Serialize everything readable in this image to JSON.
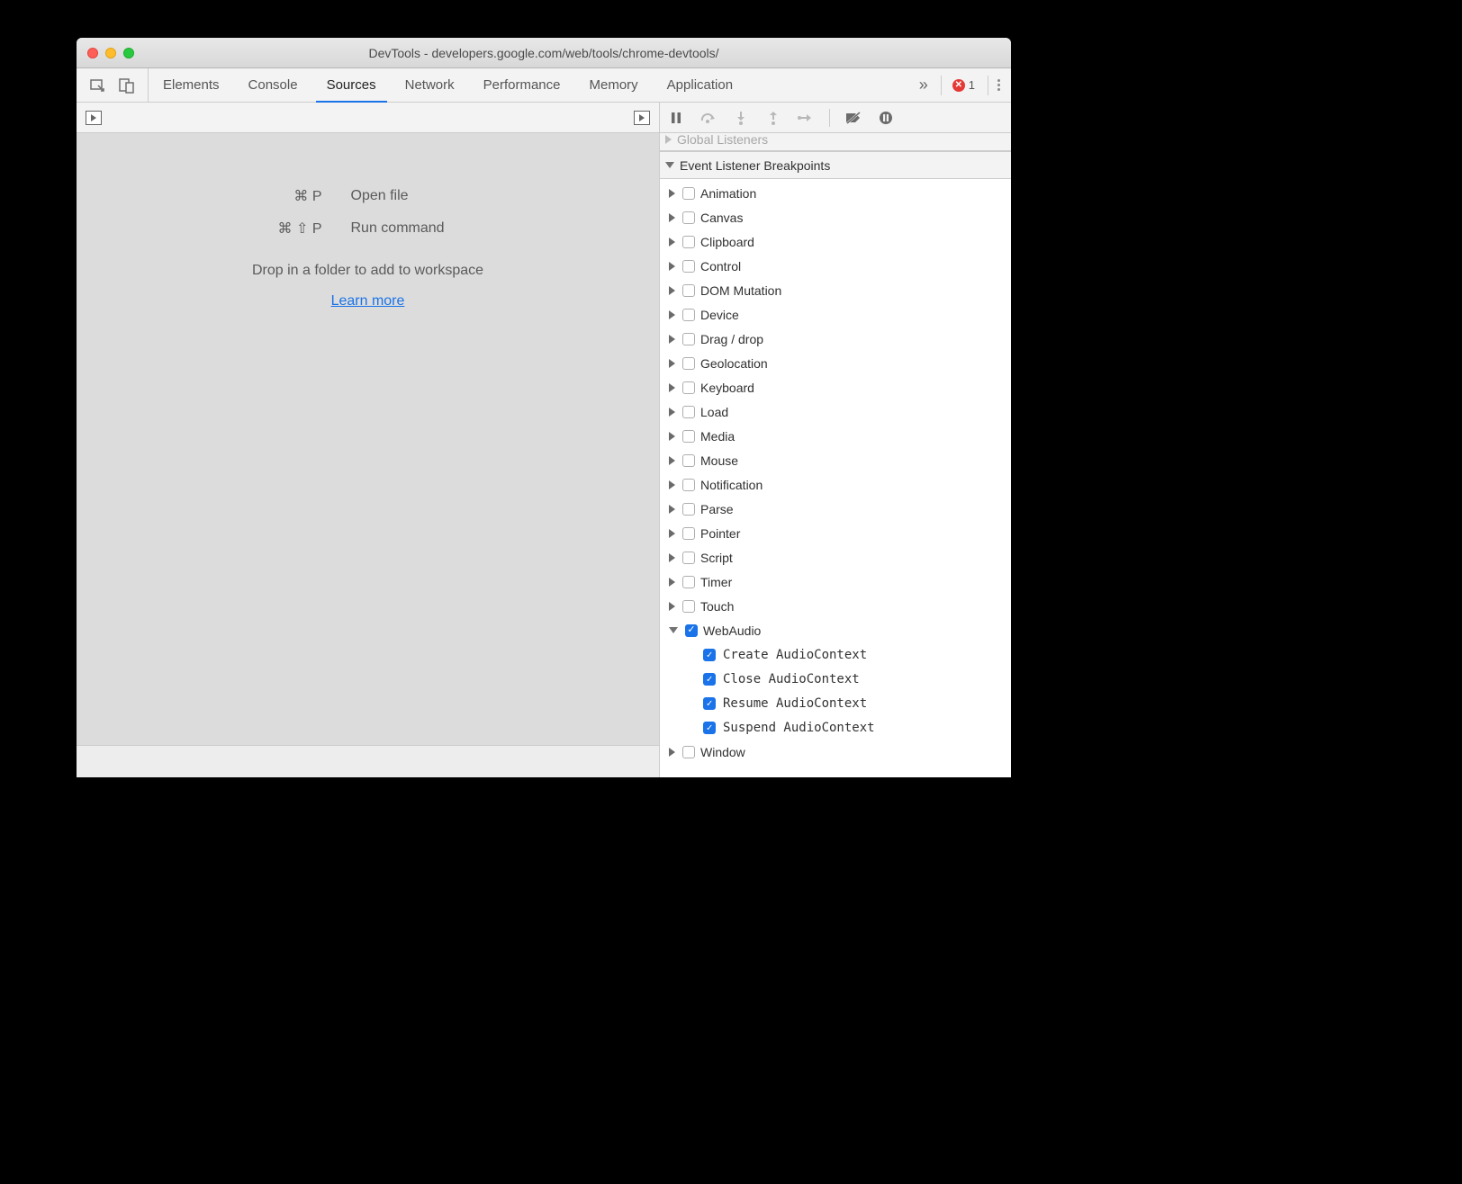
{
  "window": {
    "title": "DevTools - developers.google.com/web/tools/chrome-devtools/"
  },
  "tabs": {
    "items": [
      "Elements",
      "Console",
      "Sources",
      "Network",
      "Performance",
      "Memory",
      "Application"
    ],
    "active": "Sources",
    "error_count": "1"
  },
  "help": {
    "shortcut1_keys": "⌘ P",
    "shortcut1_label": "Open file",
    "shortcut2_keys": "⌘ ⇧ P",
    "shortcut2_label": "Run command",
    "drop_hint": "Drop in a folder to add to workspace",
    "learn_more": "Learn more"
  },
  "panels": {
    "global_listeners": "Global Listeners",
    "event_listener_breakpoints": "Event Listener Breakpoints"
  },
  "categories": [
    {
      "label": "Animation",
      "checked": false,
      "expanded": false
    },
    {
      "label": "Canvas",
      "checked": false,
      "expanded": false
    },
    {
      "label": "Clipboard",
      "checked": false,
      "expanded": false
    },
    {
      "label": "Control",
      "checked": false,
      "expanded": false
    },
    {
      "label": "DOM Mutation",
      "checked": false,
      "expanded": false
    },
    {
      "label": "Device",
      "checked": false,
      "expanded": false
    },
    {
      "label": "Drag / drop",
      "checked": false,
      "expanded": false
    },
    {
      "label": "Geolocation",
      "checked": false,
      "expanded": false
    },
    {
      "label": "Keyboard",
      "checked": false,
      "expanded": false
    },
    {
      "label": "Load",
      "checked": false,
      "expanded": false
    },
    {
      "label": "Media",
      "checked": false,
      "expanded": false
    },
    {
      "label": "Mouse",
      "checked": false,
      "expanded": false
    },
    {
      "label": "Notification",
      "checked": false,
      "expanded": false
    },
    {
      "label": "Parse",
      "checked": false,
      "expanded": false
    },
    {
      "label": "Pointer",
      "checked": false,
      "expanded": false
    },
    {
      "label": "Script",
      "checked": false,
      "expanded": false
    },
    {
      "label": "Timer",
      "checked": false,
      "expanded": false
    },
    {
      "label": "Touch",
      "checked": false,
      "expanded": false
    },
    {
      "label": "WebAudio",
      "checked": true,
      "expanded": true,
      "children": [
        {
          "label": "Create AudioContext",
          "checked": true
        },
        {
          "label": "Close AudioContext",
          "checked": true
        },
        {
          "label": "Resume AudioContext",
          "checked": true
        },
        {
          "label": "Suspend AudioContext",
          "checked": true
        }
      ]
    },
    {
      "label": "Window",
      "checked": false,
      "expanded": false
    }
  ]
}
